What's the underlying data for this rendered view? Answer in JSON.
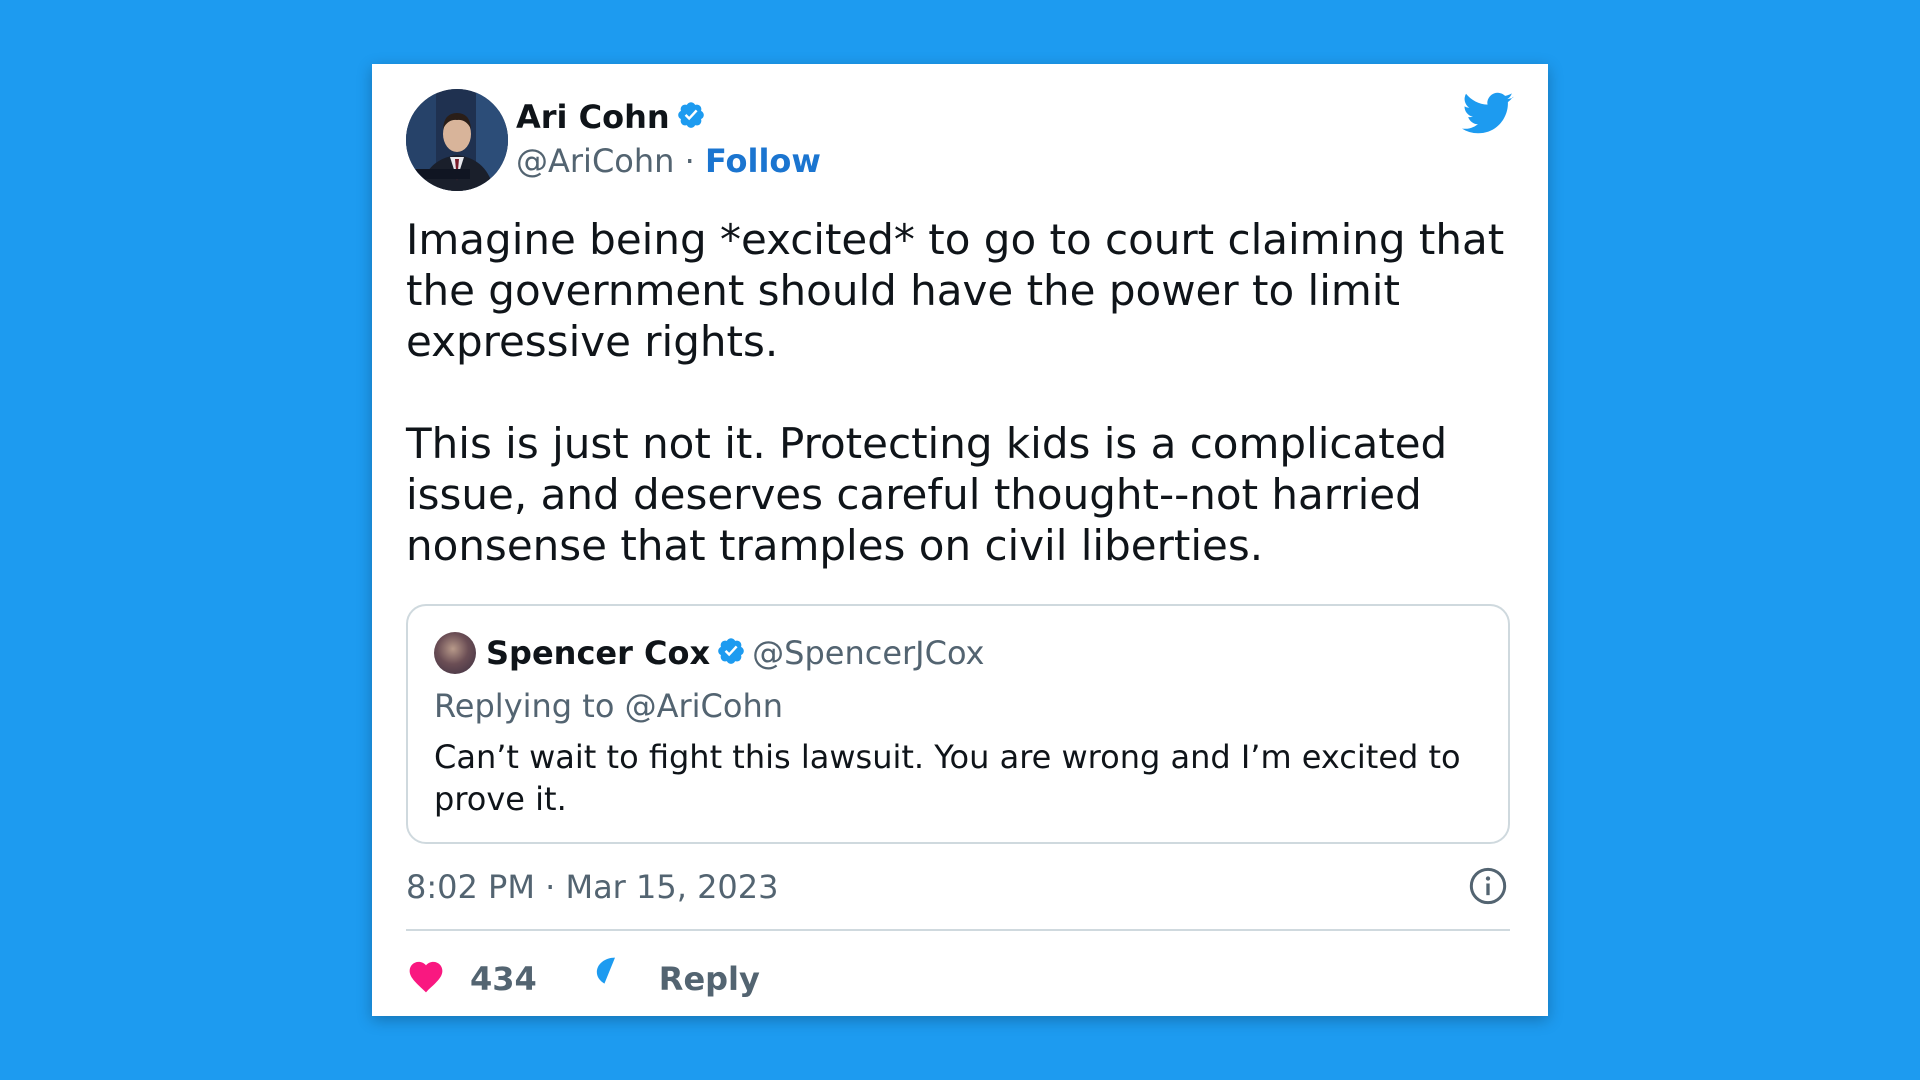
{
  "author": {
    "name": "Ari Cohn",
    "handle": "@AriCohn",
    "follow_label": "Follow"
  },
  "tweet": {
    "text": "Imagine being *excited* to go to court claiming that the government should have the power to limit expressive rights.\n\nThis is just not it. Protecting kids is a complicated issue, and deserves careful thought--not harried nonsense that tramples on civil liberties."
  },
  "quoted": {
    "name": "Spencer Cox",
    "handle": "@SpencerJCox",
    "replying_to": "Replying to @AriCohn",
    "text": "Can’t wait to fight this lawsuit. You are wrong and I’m excited to prove it."
  },
  "meta": {
    "time": "8:02 PM",
    "separator": "·",
    "date": "Mar 15, 2023"
  },
  "actions": {
    "like_count": "434",
    "reply_label": "Reply"
  },
  "icons": {
    "verified": "verified-badge-icon",
    "bird": "twitter-bird-icon",
    "info": "info-icon",
    "heart": "heart-icon",
    "reply": "reply-bubble-icon"
  },
  "colors": {
    "background": "#1d9bf0",
    "brand": "#1d9bf0",
    "follow": "#1b75d0",
    "like": "#f91880",
    "text": "#0f1419",
    "muted": "#536471"
  }
}
